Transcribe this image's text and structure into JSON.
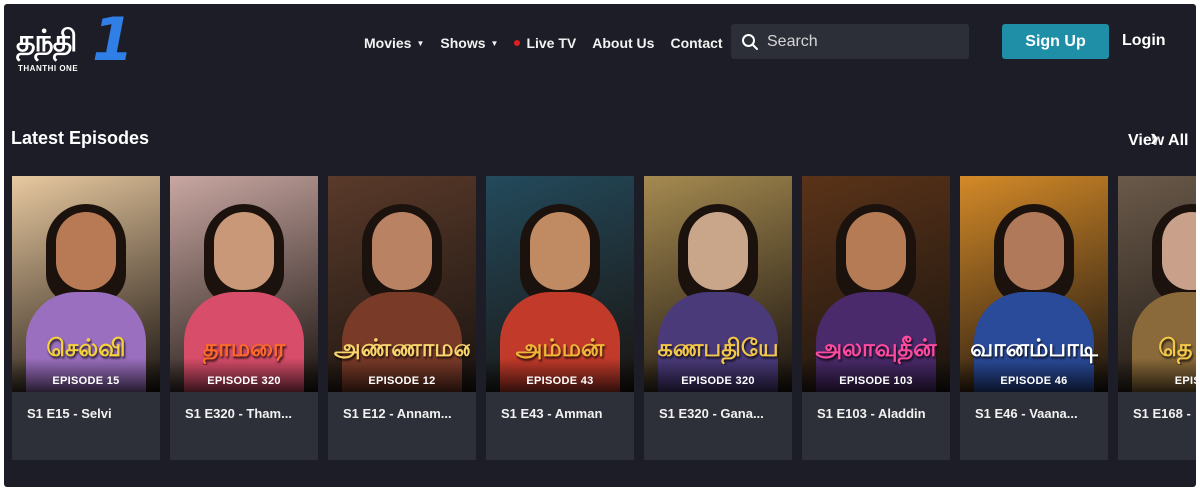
{
  "brand": {
    "logo_word": "தந்தி",
    "logo_one": "1",
    "logo_sub": "THANTHI ONE"
  },
  "nav": {
    "movies": "Movies",
    "shows": "Shows",
    "live_tv": "Live TV",
    "about": "About Us",
    "contact": "Contact"
  },
  "search": {
    "placeholder": "Search"
  },
  "auth": {
    "signup": "Sign Up",
    "login": "Login"
  },
  "section": {
    "title": "Latest Episodes",
    "view_all": "View All"
  },
  "colors": {
    "accent": "#1f8fa7",
    "live_dot": "#e0201e",
    "background": "#1c1d26",
    "card": "#2e3039"
  },
  "episodes": [
    {
      "show_logo": "செல்வி",
      "episode": "EPISODE 15",
      "title": "S1 E15 - Selvi",
      "logo_color": "#f5d23c",
      "bg": "#e8c9a0",
      "skin": "#b87a55",
      "outfit": "#9b6fbf"
    },
    {
      "show_logo": "தாமரை",
      "episode": "EPISODE 320",
      "title": "S1 E320 - Tham...",
      "logo_color": "#ff6a2a",
      "bg": "#c9a7a2",
      "skin": "#c99878",
      "outfit": "#d84d6a"
    },
    {
      "show_logo": "அண்ணாமலை",
      "episode": "EPISODE 12",
      "title": "S1 E12 - Annam...",
      "logo_color": "#f7d46c",
      "bg": "#5a3a2a",
      "skin": "#b98363",
      "outfit": "#7a3a28"
    },
    {
      "show_logo": "அம்மன்",
      "episode": "EPISODE 43",
      "title": "S1 E43 - Amman",
      "logo_color": "#f0b63a",
      "bg": "#234a5c",
      "skin": "#c08a62",
      "outfit": "#c23a2a"
    },
    {
      "show_logo": "கணபதியே",
      "episode": "EPISODE 320",
      "title": "S1 E320 - Gana...",
      "logo_color": "#f3c84a",
      "bg": "#a58a50",
      "skin": "#c9a58a",
      "outfit": "#4a3a7a"
    },
    {
      "show_logo": "அலாவுதீன்",
      "episode": "EPISODE 103",
      "title": "S1 E103 - Aladdin",
      "logo_color": "#ff4aa0",
      "bg": "#5a3318",
      "skin": "#b57b55",
      "outfit": "#4a2a6a"
    },
    {
      "show_logo": "வானம்பாடி",
      "episode": "EPISODE 46",
      "title": "S1 E46 - Vaana...",
      "logo_color": "#ffffff",
      "bg": "#d48a28",
      "skin": "#b07a5a",
      "outfit": "#2a4a9a"
    },
    {
      "show_logo": "தெ ரா",
      "episode": "EPISC",
      "title": "S1 E168 -",
      "logo_color": "#f3c84a",
      "bg": "#6a5a4a",
      "skin": "#c9a08a",
      "outfit": "#8a6a3a"
    }
  ]
}
